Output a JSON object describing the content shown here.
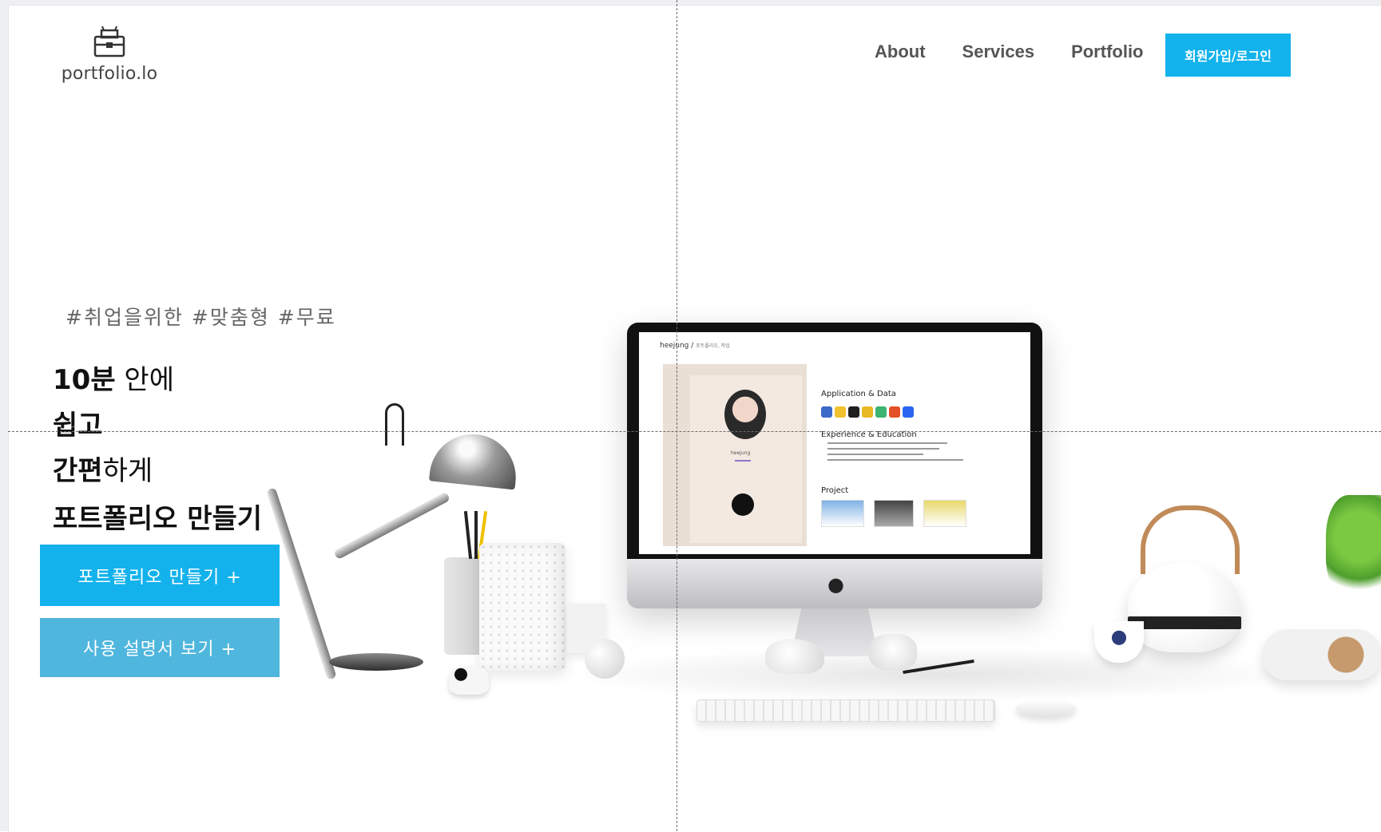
{
  "logo": {
    "text": "portfolio.lo",
    "icon": "toolbox-icon"
  },
  "nav": {
    "items": [
      "About",
      "Services",
      "Portfolio"
    ],
    "login_label": "회원가입/로그인"
  },
  "hero": {
    "hashtags": "#취업을위한 #맞춤형 #무료",
    "line1_bold": "10분",
    "line1_rest": " 안에",
    "line2_bold": "쉽고",
    "line3_bold": "간편",
    "line3_rest": "하게",
    "line4_bold": "포트폴리오 만들기",
    "cta_primary": "포트폴리오 만들기 +",
    "cta_secondary": "사용 설명서 보기 +"
  },
  "screen": {
    "site_name": "heejung /",
    "site_sub": "포트폴리오, 작업",
    "sections": [
      "Application & Data",
      "Experience & Education",
      "Project"
    ],
    "profile_name": "heejung"
  },
  "colors": {
    "accent": "#12b2ec",
    "accent_secondary": "#4fb6dd",
    "text": "#111111"
  }
}
